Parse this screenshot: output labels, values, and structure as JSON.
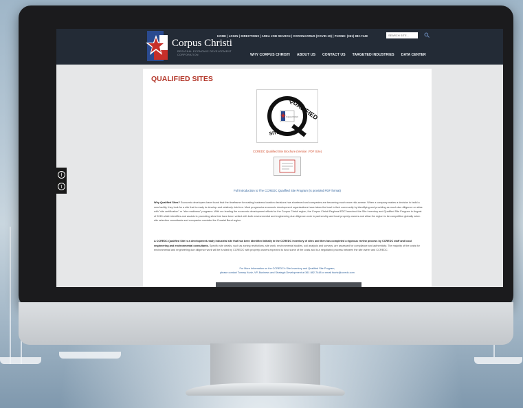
{
  "site": {
    "brand": {
      "name": "Corpus Christi",
      "subtitle": "Regional Economic Development Corporation",
      "brand_colors": {
        "blue": "#2a4a8f",
        "red": "#c62f2a",
        "white": "#ffffff"
      }
    },
    "utility_nav": {
      "text": "HOME | LOGIN | DIRECTIONS | AREA JOB SEARCH | CORONAVIRUS (COVID-19) | PHONE: (361) 882-7448"
    },
    "search": {
      "placeholder": "SEARCH SITE..."
    },
    "main_nav": {
      "items": [
        {
          "label": "WHY CORPUS CHRISTI"
        },
        {
          "label": "ABOUT US"
        },
        {
          "label": "CONTACT US"
        },
        {
          "label": "TARGETED INDUSTRIES"
        },
        {
          "label": "DATA CENTER"
        }
      ]
    },
    "social": {
      "icons": [
        "facebook-icon",
        "twitter-icon"
      ]
    }
  },
  "page": {
    "title": "QUALIFIED SITES",
    "logo_text": {
      "top": "QUALIFIED",
      "bottom": "SITE"
    },
    "brochure_link": "CCREDC Qualified Site Brochure (Version .PDF Size)",
    "intro_link": "Full Introduction to The CCREDC Qualified Site Program (is provided PDF format)",
    "para1": {
      "lead": "Why Qualified Sites?",
      "body": " Economic developers have found that the timeframe for making business location decisions has shortened and companies are becoming much more risk-averse. When a company makes a decision to build a new facility, they look for a site that is ready to develop and relatively risk-free. Most progressive economic development organizations have taken the lead in their community by identifying and providing as much due diligence on sites with \"site certification\" or \"site readiness\" programs. With our leading the economic development efforts for the Corpus Christi region, the Corpus Christi Regional EDC launched the Site Inventory and Qualified Site Program in August of 2015 which identifies and assists in promoting sites that have been vetted with both environmental and engineering due diligence work in partnership and local property owners and allow the region to be competitive globally when site selection consultants and companies consider the Coastal Bend region."
    },
    "para2": {
      "lead": "A CCREDC Qualified Site is a development-ready industrial site that has been identified initially in the CCREDC inventory of sites and then has completed a rigorous review process by CCREDC staff and local engineering and environmental consultants.",
      "body": " Specific site details, such as zoning restrictions, site work, environmental studies, soil analysis and surveys, are assessed for compliance and authenticity. The majority of the costs for environmental and engineering due diligence work will be funded by CCREDC with property owners expected to fund some of the costs and is a negotiated process between the site owner and CCREDC."
    },
    "contact": {
      "line1": "For More Information on the CCREDC's Site Inventory and Qualified Site Program,",
      "line2": "please contact Tommy Kurtz, VP, Business and Strategic Development at 361 882-7448 or email tkurtz@ccredc.com"
    }
  }
}
